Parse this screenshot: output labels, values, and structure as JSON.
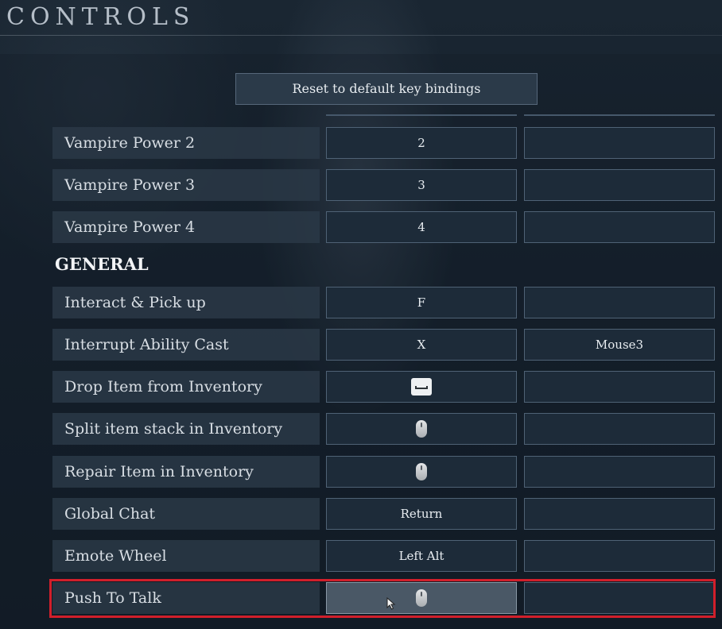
{
  "page": {
    "title": "CONTROLS"
  },
  "reset_button": {
    "label": "Reset to default key bindings"
  },
  "rows_top": [
    {
      "action": "Vampire Power 2",
      "primary": "2",
      "secondary": ""
    },
    {
      "action": "Vampire Power 3",
      "primary": "3",
      "secondary": ""
    },
    {
      "action": "Vampire Power 4",
      "primary": "4",
      "secondary": ""
    }
  ],
  "section_general": {
    "label": "GENERAL"
  },
  "rows_general": [
    {
      "action": "Interact & Pick up",
      "primary": "F",
      "secondary": ""
    },
    {
      "action": "Interrupt Ability Cast",
      "primary": "X",
      "secondary": "Mouse3"
    },
    {
      "action": "Drop Item from Inventory",
      "primary_icon": "spacebar-icon",
      "secondary": ""
    },
    {
      "action": "Split item stack in Inventory",
      "primary_icon": "mouse-icon",
      "secondary": ""
    },
    {
      "action": "Repair Item in Inventory",
      "primary_icon": "mouse-icon",
      "secondary": ""
    },
    {
      "action": "Global Chat",
      "primary": "Return",
      "secondary": ""
    },
    {
      "action": "Emote Wheel",
      "primary": "Left Alt",
      "secondary": ""
    },
    {
      "action": "Push To Talk",
      "primary_icon": "mouse-icon",
      "secondary": "",
      "highlighted": true
    }
  ],
  "colors": {
    "highlight": "#d11f2b",
    "panel": "#2a3846",
    "key_bg": "#1d2b39"
  }
}
